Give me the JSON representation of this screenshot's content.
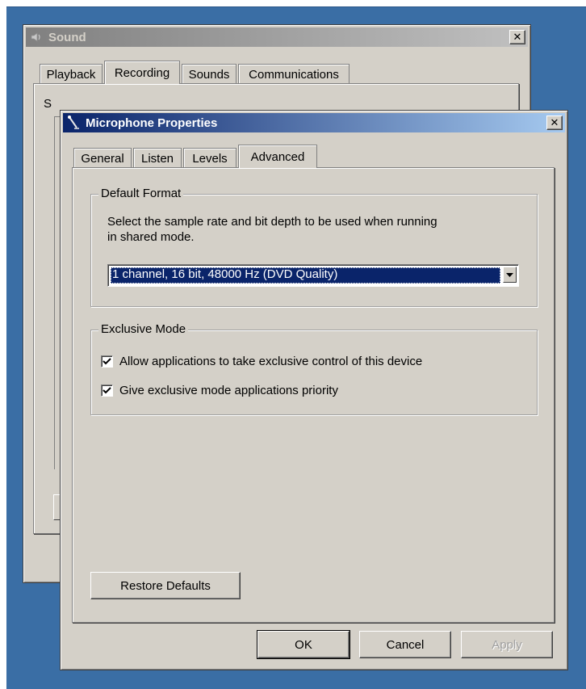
{
  "sound_window": {
    "title": "Sound",
    "close_glyph": "✕",
    "tabs": [
      {
        "label": "Playback"
      },
      {
        "label": "Recording"
      },
      {
        "label": "Sounds"
      },
      {
        "label": "Communications"
      }
    ],
    "selected_tab": "Recording",
    "obscured_text": "S"
  },
  "properties_window": {
    "title": "Microphone Properties",
    "close_glyph": "✕",
    "tabs": [
      {
        "label": "General"
      },
      {
        "label": "Listen"
      },
      {
        "label": "Levels"
      },
      {
        "label": "Advanced"
      }
    ],
    "selected_tab": "Advanced",
    "default_format": {
      "legend": "Default Format",
      "description_line1": "Select the sample rate and bit depth to be used when running",
      "description_line2": "in shared mode.",
      "selected_format": "1 channel, 16 bit, 48000 Hz (DVD Quality)"
    },
    "exclusive_mode": {
      "legend": "Exclusive Mode",
      "options": [
        {
          "label": "Allow applications to take exclusive control of this device",
          "checked": true
        },
        {
          "label": "Give exclusive mode applications priority",
          "checked": true
        }
      ]
    },
    "restore_defaults_label": "Restore Defaults",
    "ok_label": "OK",
    "cancel_label": "Cancel",
    "apply_label": "Apply",
    "apply_enabled": false
  },
  "colors": {
    "desktop": "#3a6ea5",
    "window_face": "#d4d0c8",
    "active_title": "#0a246a",
    "selection": "#0a246a"
  }
}
